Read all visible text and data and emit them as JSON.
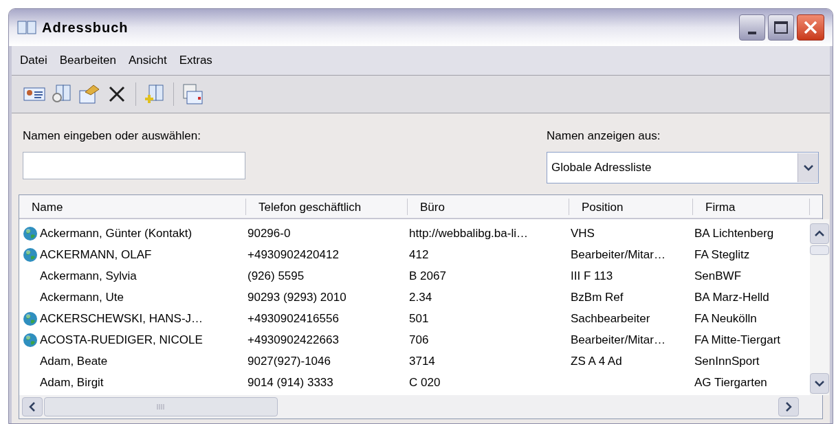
{
  "window": {
    "title": "Adressbuch"
  },
  "menu": [
    "Datei",
    "Bearbeiten",
    "Ansicht",
    "Extras"
  ],
  "search": {
    "label": "Namen eingeben oder auswählen:"
  },
  "source": {
    "label": "Namen anzeigen aus:",
    "value": "Globale Adressliste"
  },
  "table": {
    "columns": [
      "Name",
      "Telefon geschäftlich",
      "Büro",
      "Position",
      "Firma"
    ],
    "rows": [
      {
        "globe": true,
        "cells": [
          "Ackermann, Günter (Kontakt)",
          "90296-0",
          "http://webbalibg.ba-li…",
          "VHS",
          "BA Lichtenberg"
        ]
      },
      {
        "globe": true,
        "cells": [
          "ACKERMANN, OLAF",
          "+4930902420412",
          "412",
          "Bearbeiter/Mitar…",
          "FA Steglitz"
        ]
      },
      {
        "globe": false,
        "cells": [
          "Ackermann, Sylvia",
          "(926) 5595",
          "B 2067",
          "III F 113",
          "SenBWF"
        ]
      },
      {
        "globe": false,
        "cells": [
          "Ackermann, Ute",
          "90293 (9293) 2010",
          "2.34",
          "BzBm Ref",
          "BA Marz-Helld"
        ]
      },
      {
        "globe": true,
        "cells": [
          "ACKERSCHEWSKI, HANS-J…",
          "+4930902416556",
          "501",
          "Sachbearbeiter",
          "FA Neukölln"
        ]
      },
      {
        "globe": true,
        "cells": [
          "ACOSTA-RUEDIGER, NICOLE",
          "+4930902422663",
          "706",
          "Bearbeiter/Mitar…",
          "FA Mitte-Tiergart"
        ]
      },
      {
        "globe": false,
        "cells": [
          "Adam, Beate",
          "9027(927)-1046",
          "3714",
          "ZS A 4 Ad",
          "SenInnSport"
        ]
      },
      {
        "globe": false,
        "cells": [
          "Adam, Birgit",
          "9014 (914) 3333",
          "C 020",
          "",
          "AG Tiergarten"
        ]
      }
    ]
  }
}
